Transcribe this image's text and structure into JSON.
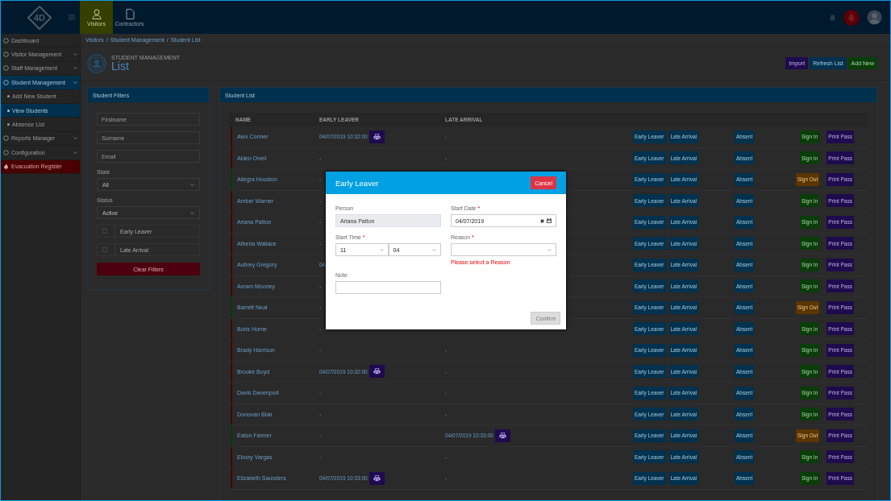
{
  "top_bar": {
    "logo_text": "4D",
    "nav_tabs": [
      {
        "label": "Visitors",
        "selected": true
      },
      {
        "label": "Contractors",
        "selected": false
      }
    ]
  },
  "sidebar": {
    "items": [
      {
        "label": "Dashboard",
        "kind": "item",
        "selected": false,
        "expandable": false
      },
      {
        "label": "Visitor Management",
        "kind": "item",
        "selected": false,
        "expandable": true
      },
      {
        "label": "Staff Management",
        "kind": "item",
        "selected": false,
        "expandable": true
      },
      {
        "label": "Student Management",
        "kind": "item",
        "selected": true,
        "expandable": true
      },
      {
        "label": "Add New Student",
        "kind": "sub",
        "selected": false
      },
      {
        "label": "View Students",
        "kind": "sub",
        "selected": true
      },
      {
        "label": "Absence List",
        "kind": "sub",
        "selected": false
      },
      {
        "label": "Reports Manager",
        "kind": "item",
        "selected": false,
        "expandable": true
      },
      {
        "label": "Configuration",
        "kind": "item",
        "selected": false,
        "expandable": true
      },
      {
        "label": "Evacuation Register",
        "kind": "alert",
        "selected": false,
        "expandable": false
      }
    ]
  },
  "breadcrumb": {
    "separator": "/",
    "items": [
      "Visitors",
      "Student Management",
      "Student List"
    ]
  },
  "page_header": {
    "subtitle": "STUDENT MANAGEMENT",
    "title": "List",
    "actions": [
      {
        "label": "Import",
        "kind": "import"
      },
      {
        "label": "Refresh List",
        "kind": "refresh"
      },
      {
        "label": "Add New",
        "kind": "add"
      }
    ]
  },
  "filters": {
    "title": "Student Filters",
    "fields": [
      {
        "kind": "text",
        "placeholder": "Firstname"
      },
      {
        "kind": "text",
        "placeholder": "Surname"
      },
      {
        "kind": "text",
        "placeholder": "Email"
      },
      {
        "kind": "select",
        "label": "State",
        "value": "All"
      },
      {
        "kind": "select",
        "label": "Status",
        "value": "Active"
      },
      {
        "kind": "checkbox",
        "label": "Early Leaver",
        "checked": false
      },
      {
        "kind": "checkbox",
        "label": "Late Arrival",
        "checked": false
      }
    ],
    "clear_button": "Clear Filters"
  },
  "student_list": {
    "title": "Student List",
    "columns": [
      "NAME",
      "EARLY LEAVER",
      "LATE ARRIVAL"
    ],
    "rows": [
      {
        "name": "Alex Conner",
        "signed_in": false,
        "early_leaver": "04/07/2019 10:32:00",
        "early_pass": true,
        "late_arrival": "-",
        "buttons": [
          "Early Leaver",
          "Late Arrival",
          "Absent",
          "Sign In",
          "Print Pass"
        ]
      },
      {
        "name": "Alden Oneil",
        "signed_in": false,
        "early_leaver": "-",
        "late_arrival": "-",
        "buttons": [
          "Early Leaver",
          "Late Arrival",
          "Absent",
          "Sign In",
          "Print Pass"
        ]
      },
      {
        "name": "Allegra Houston",
        "signed_in": true,
        "early_leaver": "-",
        "buttons": [
          "Early Leaver",
          "Late Arrival",
          "Absent",
          "Sign Out",
          "Print Pass"
        ]
      },
      {
        "name": "Amber Warner",
        "signed_in": false,
        "early_leaver": "-",
        "buttons": [
          "Early Leaver",
          "Late Arrival",
          "Absent",
          "Sign In",
          "Print Pass"
        ]
      },
      {
        "name": "Ariana Patton",
        "signed_in": false,
        "early_leaver": "-",
        "buttons": [
          "Early Leaver",
          "Late Arrival",
          "Absent",
          "Sign In",
          "Print Pass"
        ]
      },
      {
        "name": "Athena Wallace",
        "signed_in": false,
        "early_leaver": "-",
        "buttons": [
          "Early Leaver",
          "Late Arrival",
          "Absent",
          "Sign In",
          "Print Pass"
        ]
      },
      {
        "name": "Aubrey Gregory",
        "signed_in": false,
        "early_leaver": "04",
        "buttons": [
          "Early Leaver",
          "Late Arrival",
          "Absent",
          "Sign In",
          "Print Pass"
        ]
      },
      {
        "name": "Avram Mooney",
        "signed_in": false,
        "early_leaver": "-",
        "buttons": [
          "Early Leaver",
          "Late Arrival",
          "Absent",
          "Sign In",
          "Print Pass"
        ]
      },
      {
        "name": "Barrett Neal",
        "signed_in": true,
        "early_leaver": "-",
        "buttons": [
          "Early Leaver",
          "Late Arrival",
          "Absent",
          "Sign Out",
          "Print Pass"
        ]
      },
      {
        "name": "Boris Horne",
        "signed_in": false,
        "early_leaver": "-",
        "buttons": [
          "Early Leaver",
          "Late Arrival",
          "Absent",
          "Sign In",
          "Print Pass"
        ]
      },
      {
        "name": "Brady Harrison",
        "signed_in": false,
        "early_leaver": "-",
        "late_arrival": "-",
        "buttons": [
          "Early Leaver",
          "Late Arrival",
          "Absent",
          "Sign In",
          "Print Pass"
        ]
      },
      {
        "name": "Brooke Boyd",
        "signed_in": false,
        "early_leaver": "04/07/2019 10:32:00",
        "early_pass": true,
        "late_arrival": "-",
        "buttons": [
          "Early Leaver",
          "Late Arrival",
          "Absent",
          "Sign In",
          "Print Pass"
        ]
      },
      {
        "name": "Davis Davenport",
        "signed_in": false,
        "early_leaver": "-",
        "late_arrival": "-",
        "buttons": [
          "Early Leaver",
          "Late Arrival",
          "Absent",
          "Sign In",
          "Print Pass"
        ]
      },
      {
        "name": "Donovan Blair",
        "signed_in": false,
        "early_leaver": "-",
        "late_arrival": "-",
        "buttons": [
          "Early Leaver",
          "Late Arrival",
          "Absent",
          "Sign In",
          "Print Pass"
        ]
      },
      {
        "name": "Eaton Farmer",
        "signed_in": true,
        "early_leaver": "-",
        "late_arrival": "04/07/2019 10:33:00",
        "late_pass": true,
        "buttons": [
          "Early Leaver",
          "Late Arrival",
          "Absent",
          "Sign Out",
          "Print Pass"
        ]
      },
      {
        "name": "Ebony Vargas",
        "signed_in": false,
        "early_leaver": "-",
        "late_arrival": "-",
        "buttons": [
          "Early Leaver",
          "Late Arrival",
          "Absent",
          "Sign In",
          "Print Pass"
        ]
      },
      {
        "name": "Elizabeth Saunders",
        "signed_in": false,
        "early_leaver": "04/07/2019 10:33:00",
        "early_pass": true,
        "late_arrival": "-",
        "buttons": [
          "Early Leaver",
          "Late Arrival",
          "Absent",
          "Sign In",
          "Print Pass"
        ]
      }
    ]
  },
  "dialog": {
    "title": "Early Leaver",
    "cancel_button": "Cancel",
    "fields": [
      {
        "kind": "readonly",
        "label": "Person",
        "value": "Ariana Patton"
      },
      {
        "kind": "date",
        "label": "Start Date",
        "required_mark": "*",
        "value": "04/07/2019"
      },
      {
        "kind": "time",
        "label": "Start Time",
        "required_mark": "*",
        "hour": "11",
        "minute": "04"
      },
      {
        "kind": "select",
        "label": "Reason",
        "required_mark": "*",
        "error": "Please select a Reason"
      },
      {
        "kind": "text",
        "label": "Note"
      }
    ],
    "confirm_button": {
      "label": "Confirm",
      "disabled": true
    }
  }
}
